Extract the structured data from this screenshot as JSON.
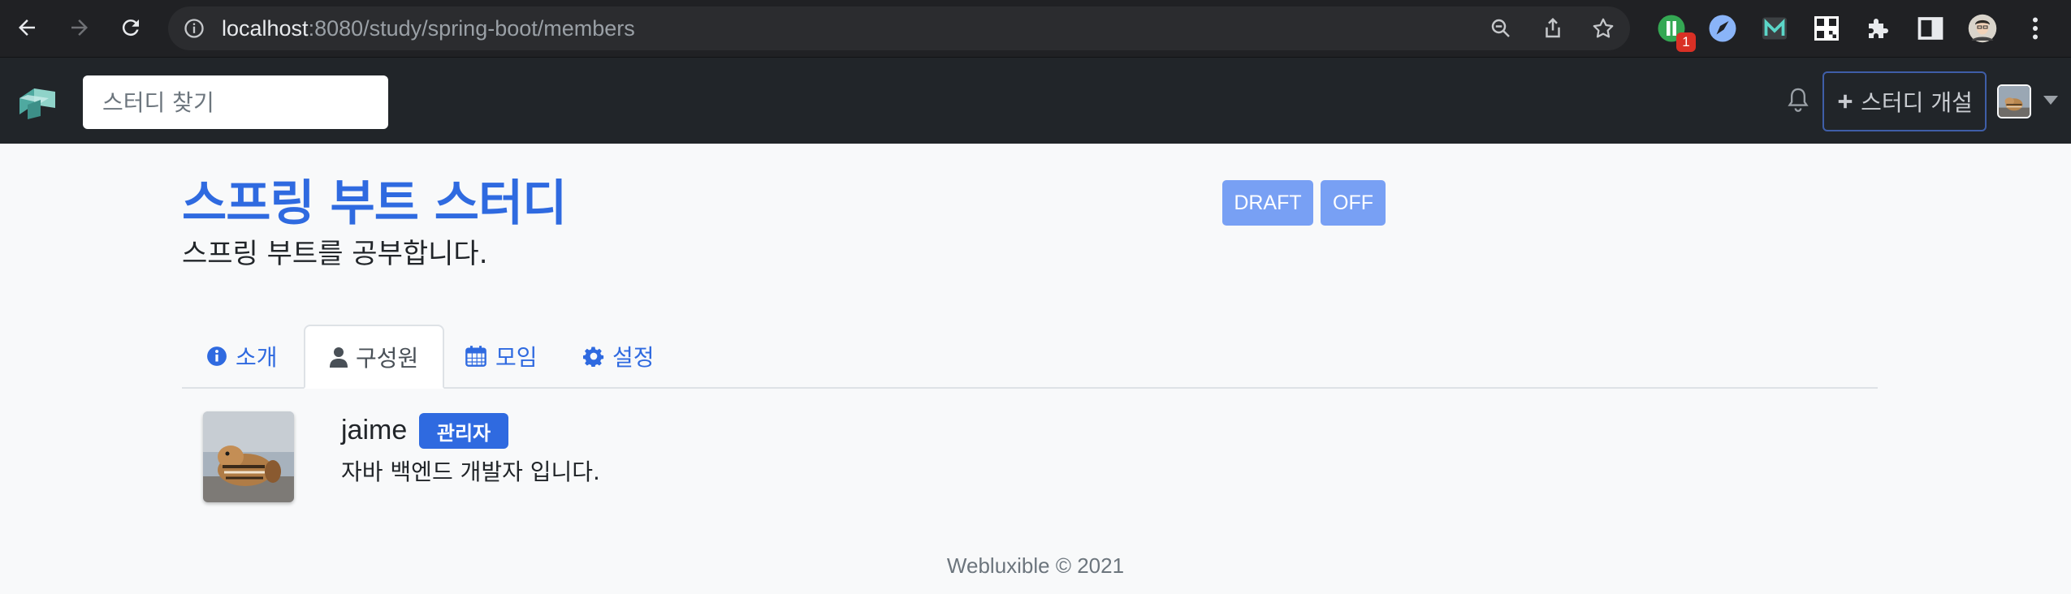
{
  "browser": {
    "url_host": "localhost",
    "url_path": ":8080/study/spring-boot/members",
    "extension_badge": "1"
  },
  "navbar": {
    "search_placeholder": "스터디 찾기",
    "create_study_label": "스터디 개설"
  },
  "study": {
    "title": "스프링 부트 스터디",
    "short_description": "스프링 부트를 공부합니다.",
    "status_tags": [
      "DRAFT",
      "OFF"
    ]
  },
  "tabs": [
    {
      "label": "소개",
      "icon": "info-circle-icon",
      "active": false
    },
    {
      "label": "구성원",
      "icon": "user-icon",
      "active": true
    },
    {
      "label": "모임",
      "icon": "calendar-icon",
      "active": false
    },
    {
      "label": "설정",
      "icon": "gear-icon",
      "active": false
    }
  ],
  "members": [
    {
      "name": "jaime",
      "role_badge": "관리자",
      "bio": "자바 백엔드 개발자 입니다."
    }
  ],
  "footer": {
    "text": "Webluxible © 2021"
  },
  "colors": {
    "primary": "#2f6ae0",
    "navbar_bg": "#212529",
    "tag_bg": "#78a0f4"
  }
}
